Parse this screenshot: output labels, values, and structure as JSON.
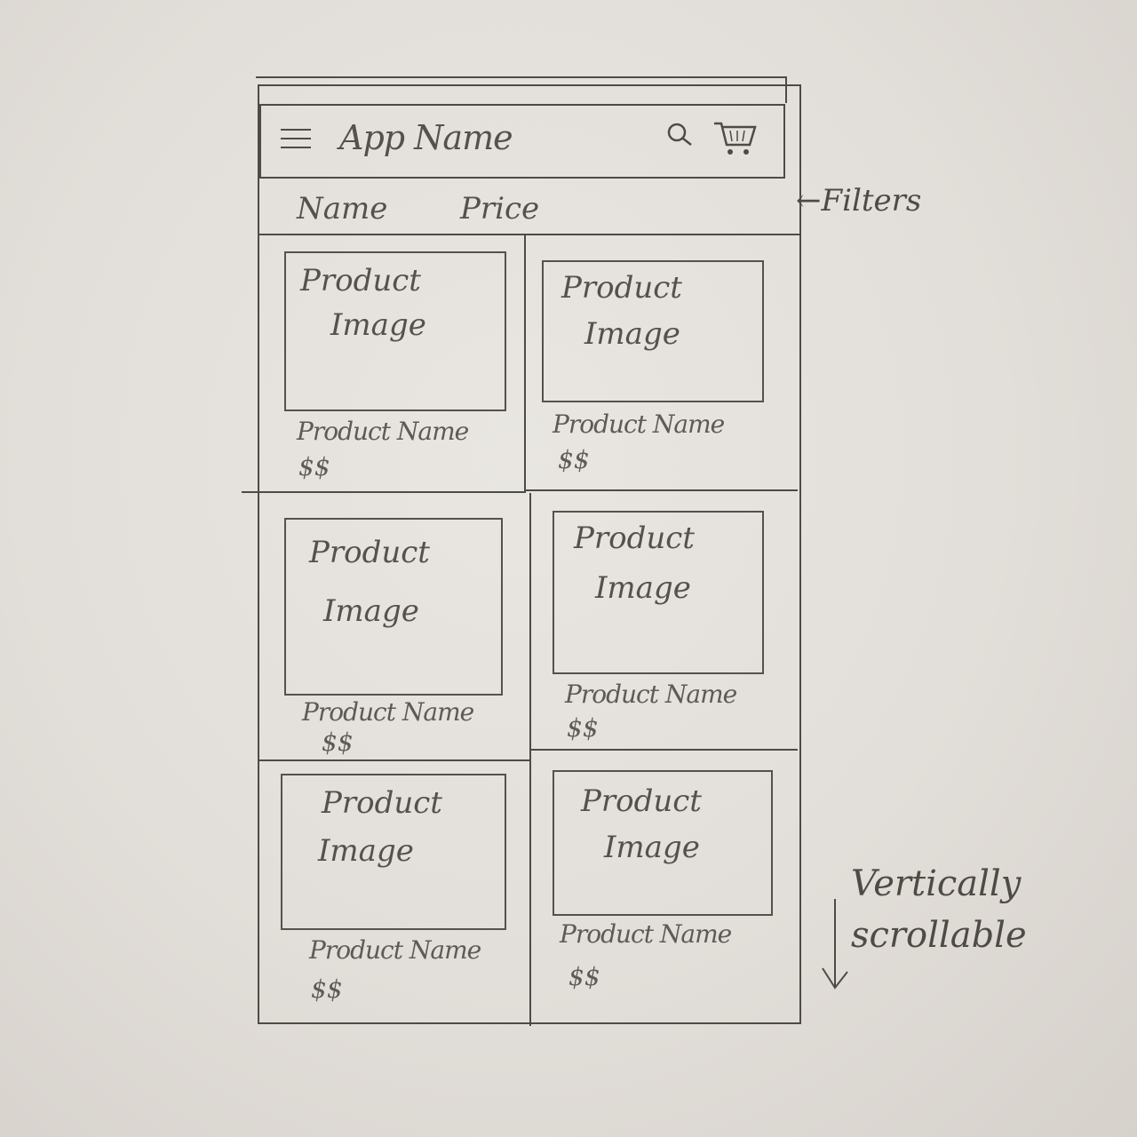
{
  "header": {
    "app_name": "App Name",
    "menu_icon": "hamburger-menu-icon",
    "search_icon": "search-icon",
    "cart_icon": "cart-icon"
  },
  "filters": {
    "items": [
      "Name",
      "Price"
    ]
  },
  "products": [
    {
      "image_label_1": "Product",
      "image_label_2": "Image",
      "name": "Product Name",
      "price": "$$"
    },
    {
      "image_label_1": "Product",
      "image_label_2": "Image",
      "name": "Product Name",
      "price": "$$"
    },
    {
      "image_label_1": "Product",
      "image_label_2": "Image",
      "name": "Product Name",
      "price": "$$"
    },
    {
      "image_label_1": "Product",
      "image_label_2": "Image",
      "name": "Product Name",
      "price": "$$"
    },
    {
      "image_label_1": "Product",
      "image_label_2": "Image",
      "name": "Product Name",
      "price": "$$"
    },
    {
      "image_label_1": "Product",
      "image_label_2": "Image",
      "name": "Product Name",
      "price": "$$"
    }
  ],
  "annotations": {
    "filters_note": "←Filters",
    "scroll_note_line1": "Vertically",
    "scroll_note_line2": "scrollable"
  }
}
